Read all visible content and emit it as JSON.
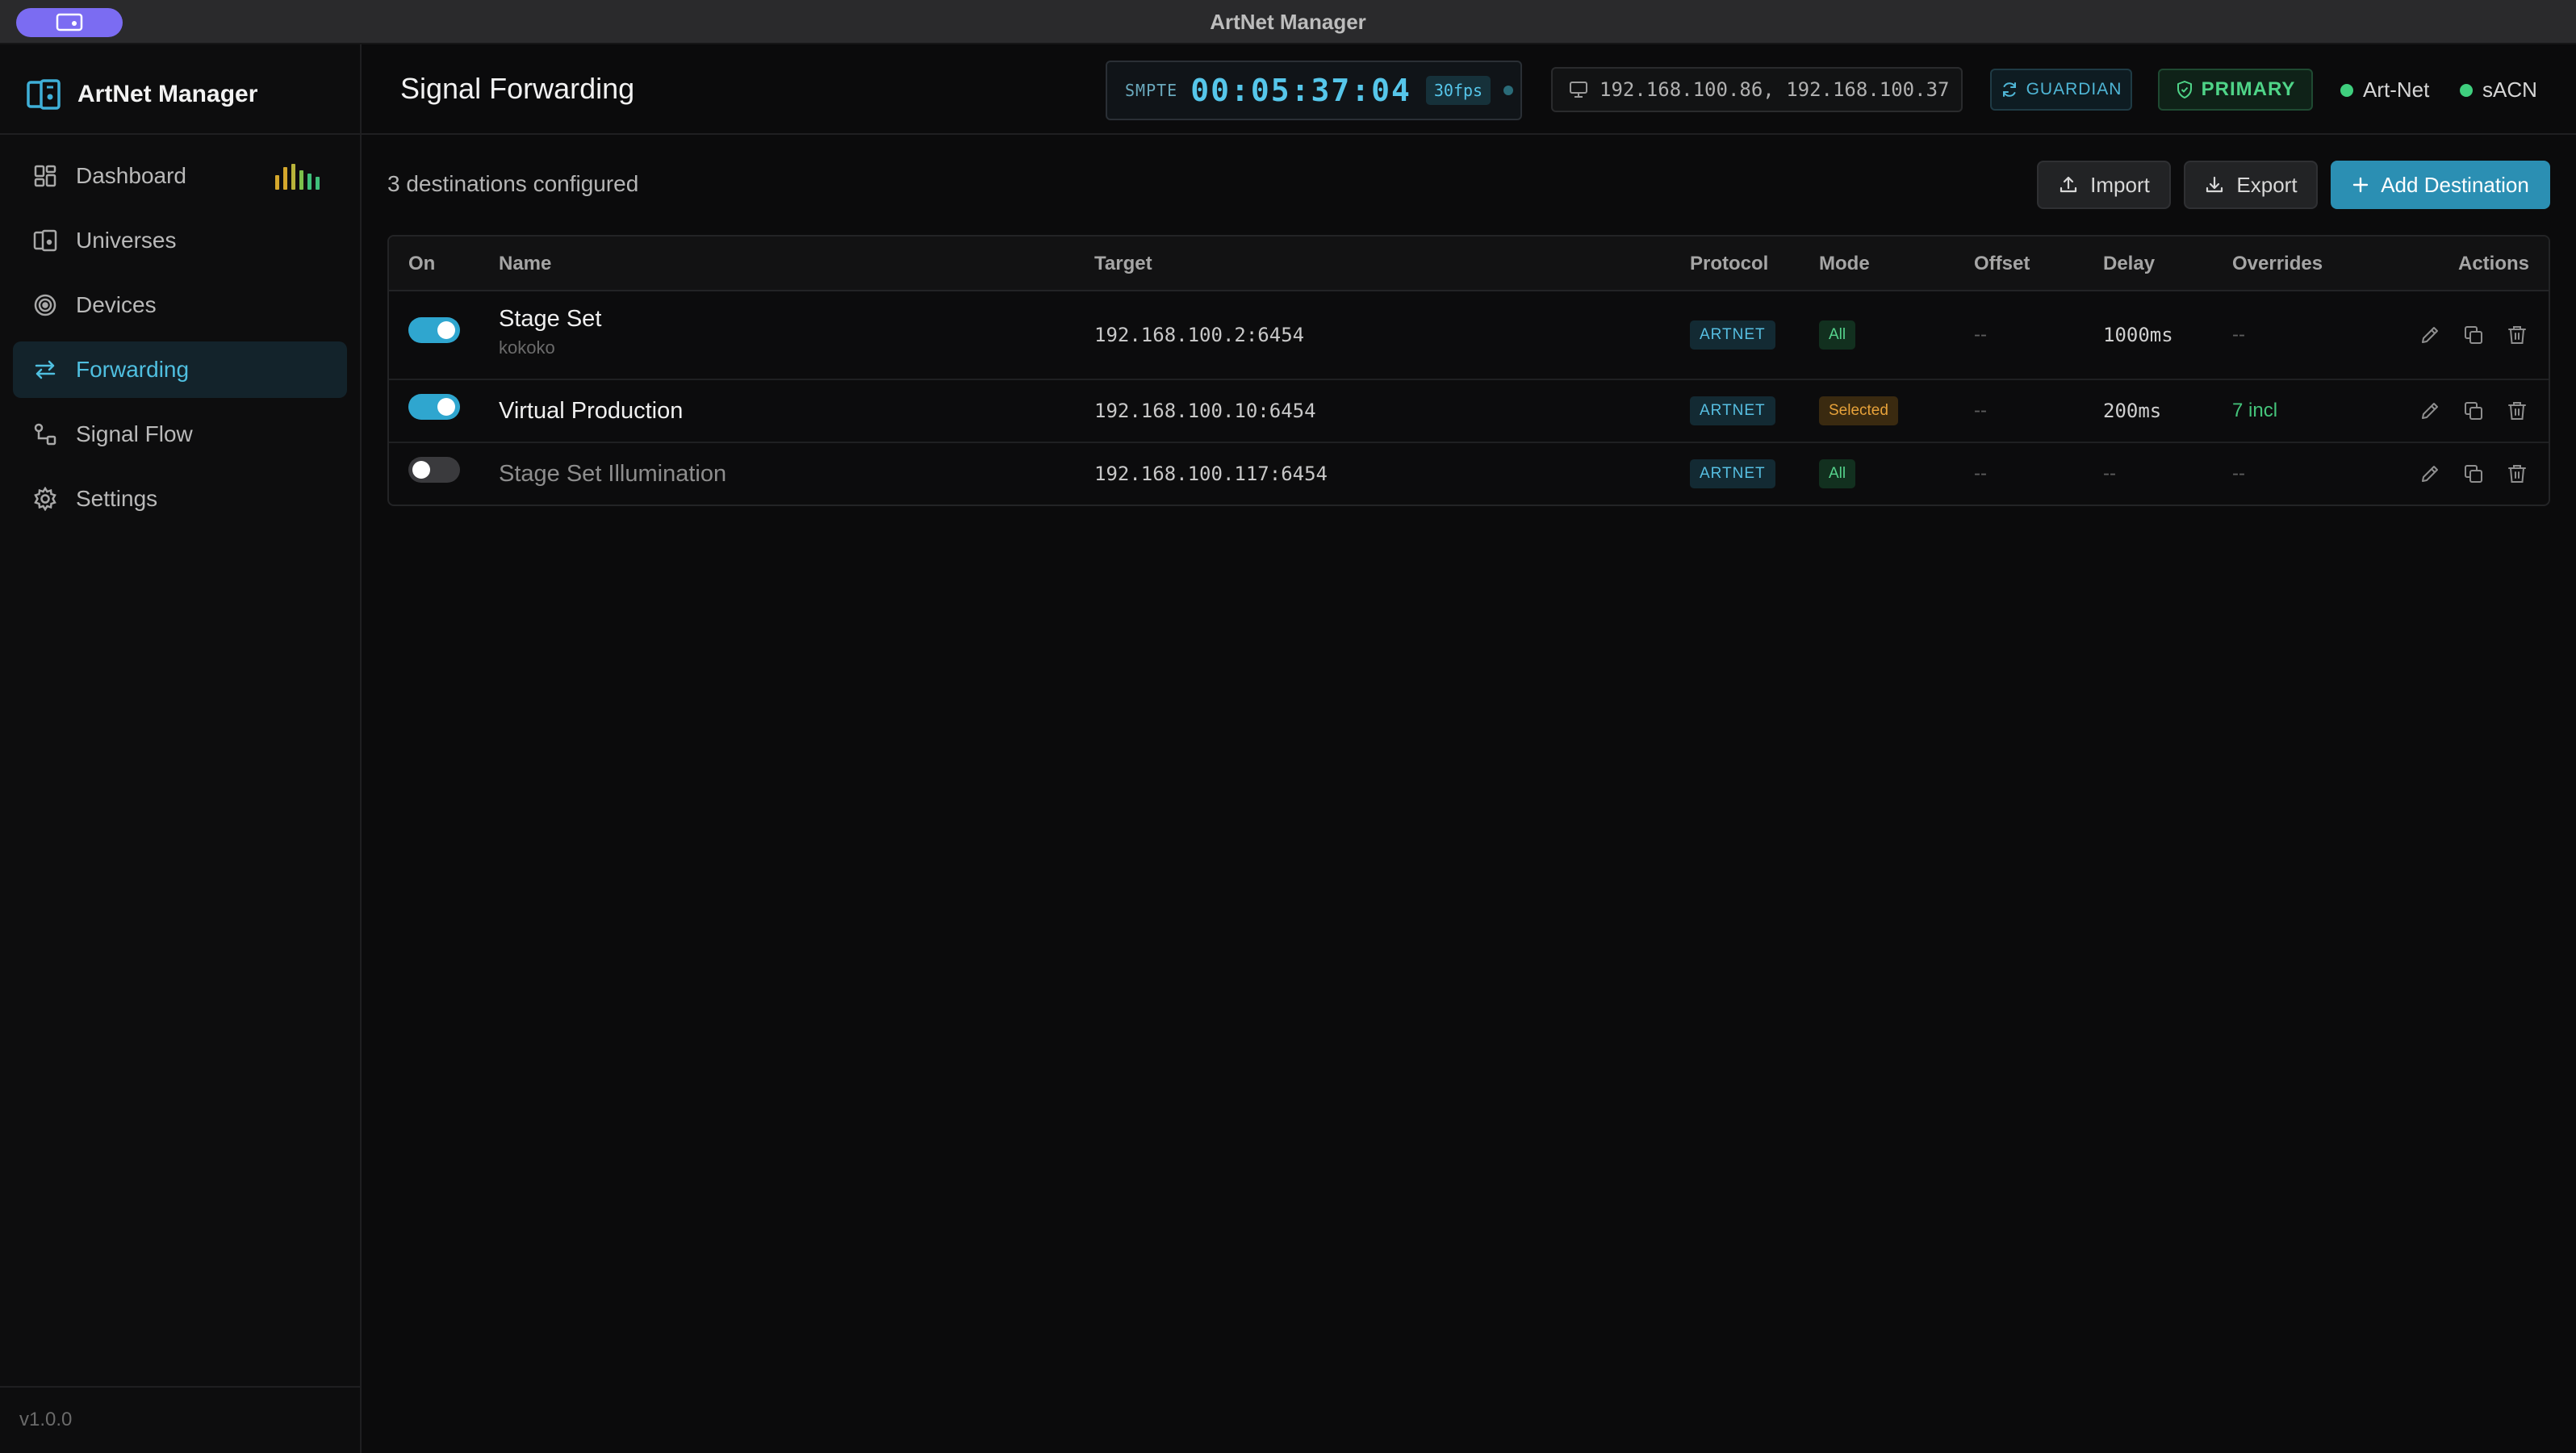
{
  "window": {
    "title": "ArtNet Manager"
  },
  "app": {
    "name": "ArtNet Manager",
    "version": "v1.0.0"
  },
  "sidebar": {
    "items": [
      {
        "label": "Dashboard",
        "icon": "dashboard-grid-icon",
        "active": false
      },
      {
        "label": "Universes",
        "icon": "universes-icon",
        "active": false
      },
      {
        "label": "Devices",
        "icon": "devices-radar-icon",
        "active": false
      },
      {
        "label": "Forwarding",
        "icon": "forwarding-arrows-icon",
        "active": true
      },
      {
        "label": "Signal Flow",
        "icon": "signal-flow-icon",
        "active": false
      },
      {
        "label": "Settings",
        "icon": "gear-icon",
        "active": false
      }
    ]
  },
  "header": {
    "page_title": "Signal Forwarding",
    "smpte": {
      "label": "SMPTE",
      "timecode": "00:05:37:04",
      "fps": "30fps"
    },
    "ips": "192.168.100.86, 192.168.100.37",
    "guardian": "GUARDIAN",
    "primary": "PRIMARY",
    "status": [
      {
        "label": "Art-Net",
        "color": "#3fcf7e"
      },
      {
        "label": "sACN",
        "color": "#3fcf7e"
      }
    ]
  },
  "main": {
    "count_text": "3 destinations configured",
    "buttons": {
      "import": "Import",
      "export": "Export",
      "add": "Add Destination"
    },
    "columns": [
      "On",
      "Name",
      "Target",
      "Protocol",
      "Mode",
      "Offset",
      "Delay",
      "Overrides",
      "Actions"
    ],
    "rows": [
      {
        "on": true,
        "name": "Stage Set",
        "sub": "kokoko",
        "target": "192.168.100.2:6454",
        "protocol": "ARTNET",
        "mode": "All",
        "offset": "--",
        "delay": "1000ms",
        "overrides": "--"
      },
      {
        "on": true,
        "name": "Virtual Production",
        "sub": "",
        "target": "192.168.100.10:6454",
        "protocol": "ARTNET",
        "mode": "Selected",
        "offset": "--",
        "delay": "200ms",
        "overrides": "7 incl"
      },
      {
        "on": false,
        "name": "Stage Set Illumination",
        "sub": "",
        "target": "192.168.100.117:6454",
        "protocol": "ARTNET",
        "mode": "All",
        "offset": "--",
        "delay": "--",
        "overrides": "--"
      }
    ]
  },
  "colors": {
    "accent": "#2fa6cf",
    "success": "#3fcf7e",
    "warning": "#e7a23a",
    "brand_pill": "#7b6cf2"
  }
}
